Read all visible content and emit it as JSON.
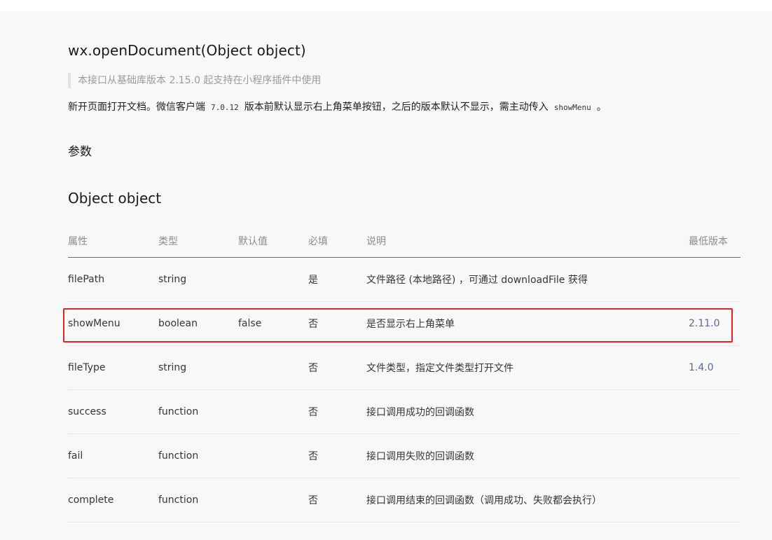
{
  "api": {
    "title": "wx.openDocument(Object object)",
    "note": "本接口从基础库版本 2.15.0 起支持在小程序插件中使用",
    "desc_before": "新开页面打开文档。微信客户端",
    "desc_code_version": "7.0.12",
    "desc_middle": "版本前默认显示右上角菜单按钮，之后的版本默认不显示，需主动传入",
    "desc_code_param": "showMenu",
    "desc_after": "。"
  },
  "section": {
    "params_title": "参数",
    "object_title": "Object object"
  },
  "table": {
    "headers": {
      "name": "属性",
      "type": "类型",
      "default": "默认值",
      "required": "必填",
      "desc": "说明",
      "version": "最低版本"
    },
    "rows": [
      {
        "name": "filePath",
        "type": "string",
        "default": "",
        "required": "是",
        "desc": "文件路径 (本地路径) ，可通过 downloadFile 获得",
        "version": ""
      },
      {
        "name": "showMenu",
        "type": "boolean",
        "default": "false",
        "required": "否",
        "desc": "是否显示右上角菜单",
        "version": "2.11.0"
      },
      {
        "name": "fileType",
        "type": "string",
        "default": "",
        "required": "否",
        "desc": "文件类型，指定文件类型打开文件",
        "version": "1.4.0"
      },
      {
        "name": "success",
        "type": "function",
        "default": "",
        "required": "否",
        "desc": "接口调用成功的回调函数",
        "version": ""
      },
      {
        "name": "fail",
        "type": "function",
        "default": "",
        "required": "否",
        "desc": "接口调用失败的回调函数",
        "version": ""
      },
      {
        "name": "complete",
        "type": "function",
        "default": "",
        "required": "否",
        "desc": "接口调用结束的回调函数（调用成功、失败都会执行）",
        "version": ""
      }
    ]
  },
  "colors": {
    "highlight": "#e32525",
    "link": "#576b95"
  }
}
